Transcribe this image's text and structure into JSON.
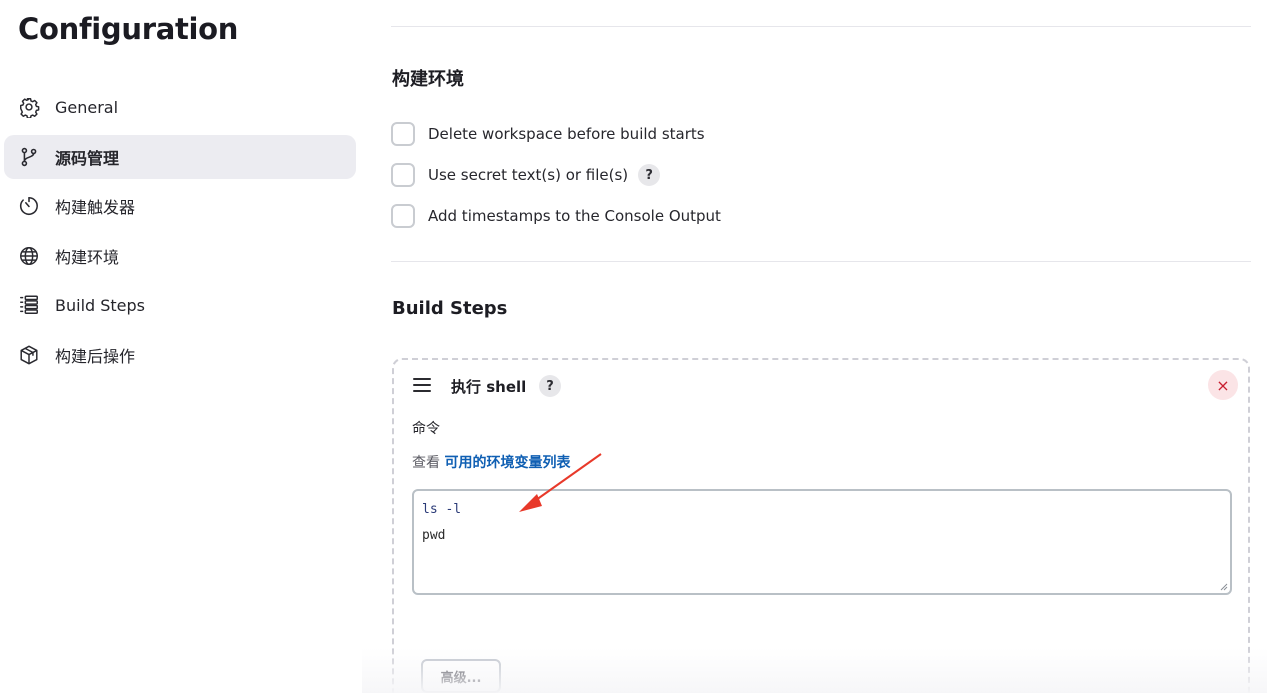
{
  "page": {
    "title": "Configuration"
  },
  "sidebar": {
    "items": [
      {
        "label": "General",
        "icon": "gear-icon",
        "active": false
      },
      {
        "label": "源码管理",
        "icon": "git-branch-icon",
        "active": true
      },
      {
        "label": "构建触发器",
        "icon": "timer-icon",
        "active": false
      },
      {
        "label": "构建环境",
        "icon": "globe-icon",
        "active": false
      },
      {
        "label": "Build Steps",
        "icon": "list-steps-icon",
        "active": false
      },
      {
        "label": "构建后操作",
        "icon": "package-icon",
        "active": false
      }
    ]
  },
  "build_env": {
    "title": "构建环境",
    "options": [
      {
        "label": "Delete workspace before build starts",
        "checked": false,
        "help": false
      },
      {
        "label": "Use secret text(s) or file(s)",
        "checked": false,
        "help": true
      },
      {
        "label": "Add timestamps to the Console Output",
        "checked": false,
        "help": false
      }
    ]
  },
  "build_steps": {
    "title": "Build Steps",
    "step": {
      "title": "执行 shell",
      "help_label": "?",
      "close_label": "×",
      "command_label": "命令",
      "env_prefix": "查看",
      "env_link": "可用的环境变量列表",
      "command_lines": [
        "ls -l",
        "pwd"
      ],
      "advanced_label": "高级..."
    }
  },
  "colors": {
    "active_nav_bg": "#ececf1",
    "link": "#0f5fb3",
    "close_bg": "#fbe4e6",
    "close_fg": "#c81e2f",
    "annotation_arrow": "#e8392a"
  }
}
